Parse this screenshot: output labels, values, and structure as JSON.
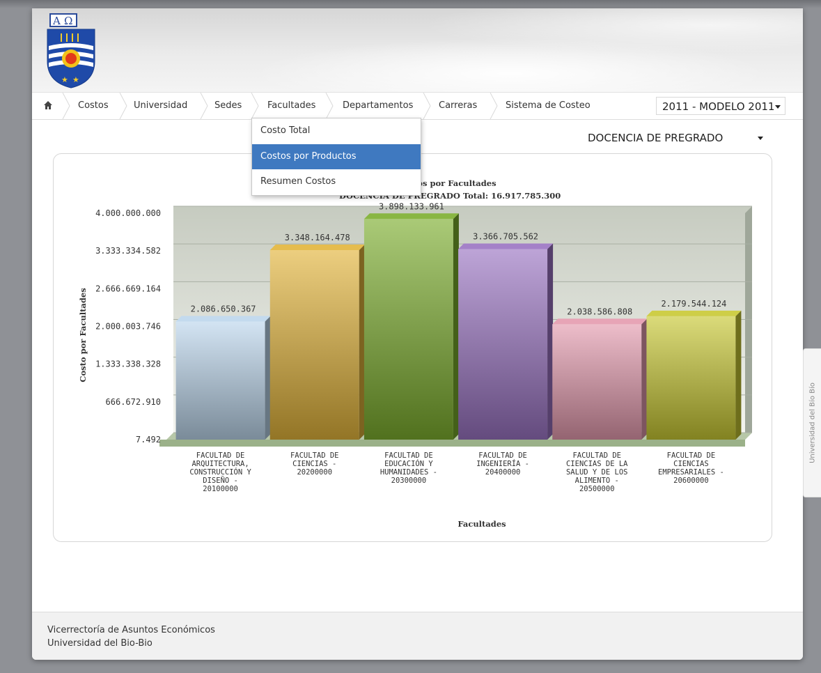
{
  "nav": {
    "items": [
      "Costos",
      "Universidad",
      "Sedes",
      "Facultades",
      "Departamentos",
      "Carreras",
      "Sistema de Costeo"
    ],
    "year_select": "2011 - MODELO 2011"
  },
  "dropdown": {
    "items": [
      "Costo Total",
      "Costos por Productos",
      "Resumen Costos"
    ],
    "active_index": 1
  },
  "program_select": "DOCENCIA DE PREGRADO",
  "colors": {
    "menu_active": "#3f79c0",
    "bars": [
      "#bcd6ec",
      "#e2b43a",
      "#7cae2e",
      "#9a73c2",
      "#e49aae",
      "#c8c832"
    ]
  },
  "chart_data": {
    "type": "bar",
    "title": "tos por Facultades",
    "subtitle": "DOCENCIA DE PREGRADO Total: 16.917.785.300",
    "xlabel": "Facultades",
    "ylabel": "Costo por Facultades",
    "ylim": [
      7492,
      4000000000
    ],
    "yticks": [
      "4.000.000.000",
      "3.333.334.582",
      "2.666.669.164",
      "2.000.003.746",
      "1.333.338.328",
      "666.672.910",
      "7.492"
    ],
    "categories": [
      [
        "FACULTAD DE",
        "ARQUITECTURA,",
        "CONSTRUCCIÓN Y",
        "DISEÑO -",
        "20100000"
      ],
      [
        "FACULTAD DE",
        "CIENCIAS -",
        "20200000"
      ],
      [
        "FACULTAD DE",
        "EDUCACIÓN Y",
        "HUMANIDADES -",
        "20300000"
      ],
      [
        "FACULTAD DE",
        "INGENIERÍA -",
        "20400000"
      ],
      [
        "FACULTAD DE",
        "CIENCIAS DE LA",
        "SALUD Y DE LOS",
        "ALIMENTO -",
        "20500000"
      ],
      [
        "FACULTAD DE",
        "CIENCIAS",
        "EMPRESARIALES -",
        "20600000"
      ]
    ],
    "values": [
      2086650367,
      3348164478,
      3898133961,
      3366705562,
      2038586808,
      2179544124
    ],
    "value_labels": [
      "2.086.650.367",
      "3.348.164.478",
      "3.898.133.961",
      "3.366.705.562",
      "2.038.586.808",
      "2.179.544.124"
    ],
    "grid": true
  },
  "footer": {
    "line1": "Vicerrectoría de Asuntos Económicos",
    "line2": "Universidad del Bio-Bio"
  },
  "side_tab": "Universidad del Bío Bío"
}
